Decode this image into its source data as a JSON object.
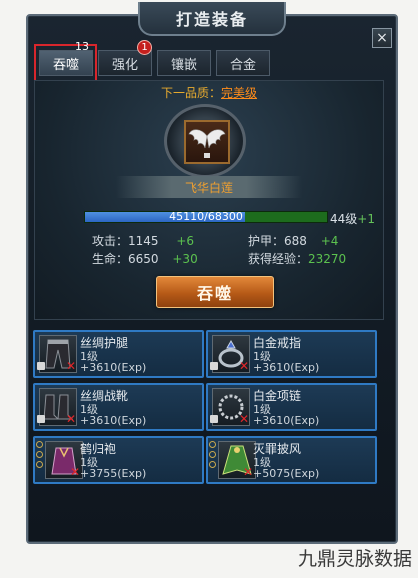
{
  "window": {
    "title": "打造装备",
    "close_label": "×"
  },
  "tabs": [
    {
      "label": "吞噬"
    },
    {
      "label": "强化"
    },
    {
      "label": "镶嵌"
    },
    {
      "label": "合金"
    }
  ],
  "badges": {
    "devour_count": "13",
    "enhance_count": "1"
  },
  "main": {
    "next_quality_label": "下一品质：",
    "next_quality_value": "完美级",
    "item_name": "飞华白莲",
    "exp_text": "45110/68300",
    "exp_fraction": 0.66,
    "level": "44级",
    "level_plus": "+1",
    "stats": {
      "attack_label": "攻击：1145",
      "attack_plus": "+6",
      "armor_label": "护甲：688",
      "armor_plus": "+4",
      "life_label": "生命：6650",
      "life_plus": "+30",
      "gain_label": "获得经验：",
      "gain_value": "23270"
    },
    "devour_button": "吞噬"
  },
  "materials": [
    {
      "name": "丝绸护腿",
      "level": "1级",
      "exp": "+3610(Exp)",
      "icon": "leggings-icon"
    },
    {
      "name": "白金戒指",
      "level": "1级",
      "exp": "+3610(Exp)",
      "icon": "ring-icon"
    },
    {
      "name": "丝绸战靴",
      "level": "1级",
      "exp": "+3610(Exp)",
      "icon": "boots-icon"
    },
    {
      "name": "白金项链",
      "level": "1级",
      "exp": "+3610(Exp)",
      "icon": "necklace-icon"
    },
    {
      "name": "鹤归袍",
      "level": "1级",
      "exp": "+3755(Exp)",
      "icon": "robe-icon"
    },
    {
      "name": "灭罪披风",
      "level": "1级",
      "exp": "+5075(Exp)",
      "icon": "cloak-icon"
    }
  ],
  "watermark": "九鼎灵脉数据",
  "colors": {
    "accent_orange": "#e8ab2e",
    "exp_blue": "#2c66c3",
    "bonus_green": "#5cc24f",
    "card_border": "#2f7ac4"
  }
}
